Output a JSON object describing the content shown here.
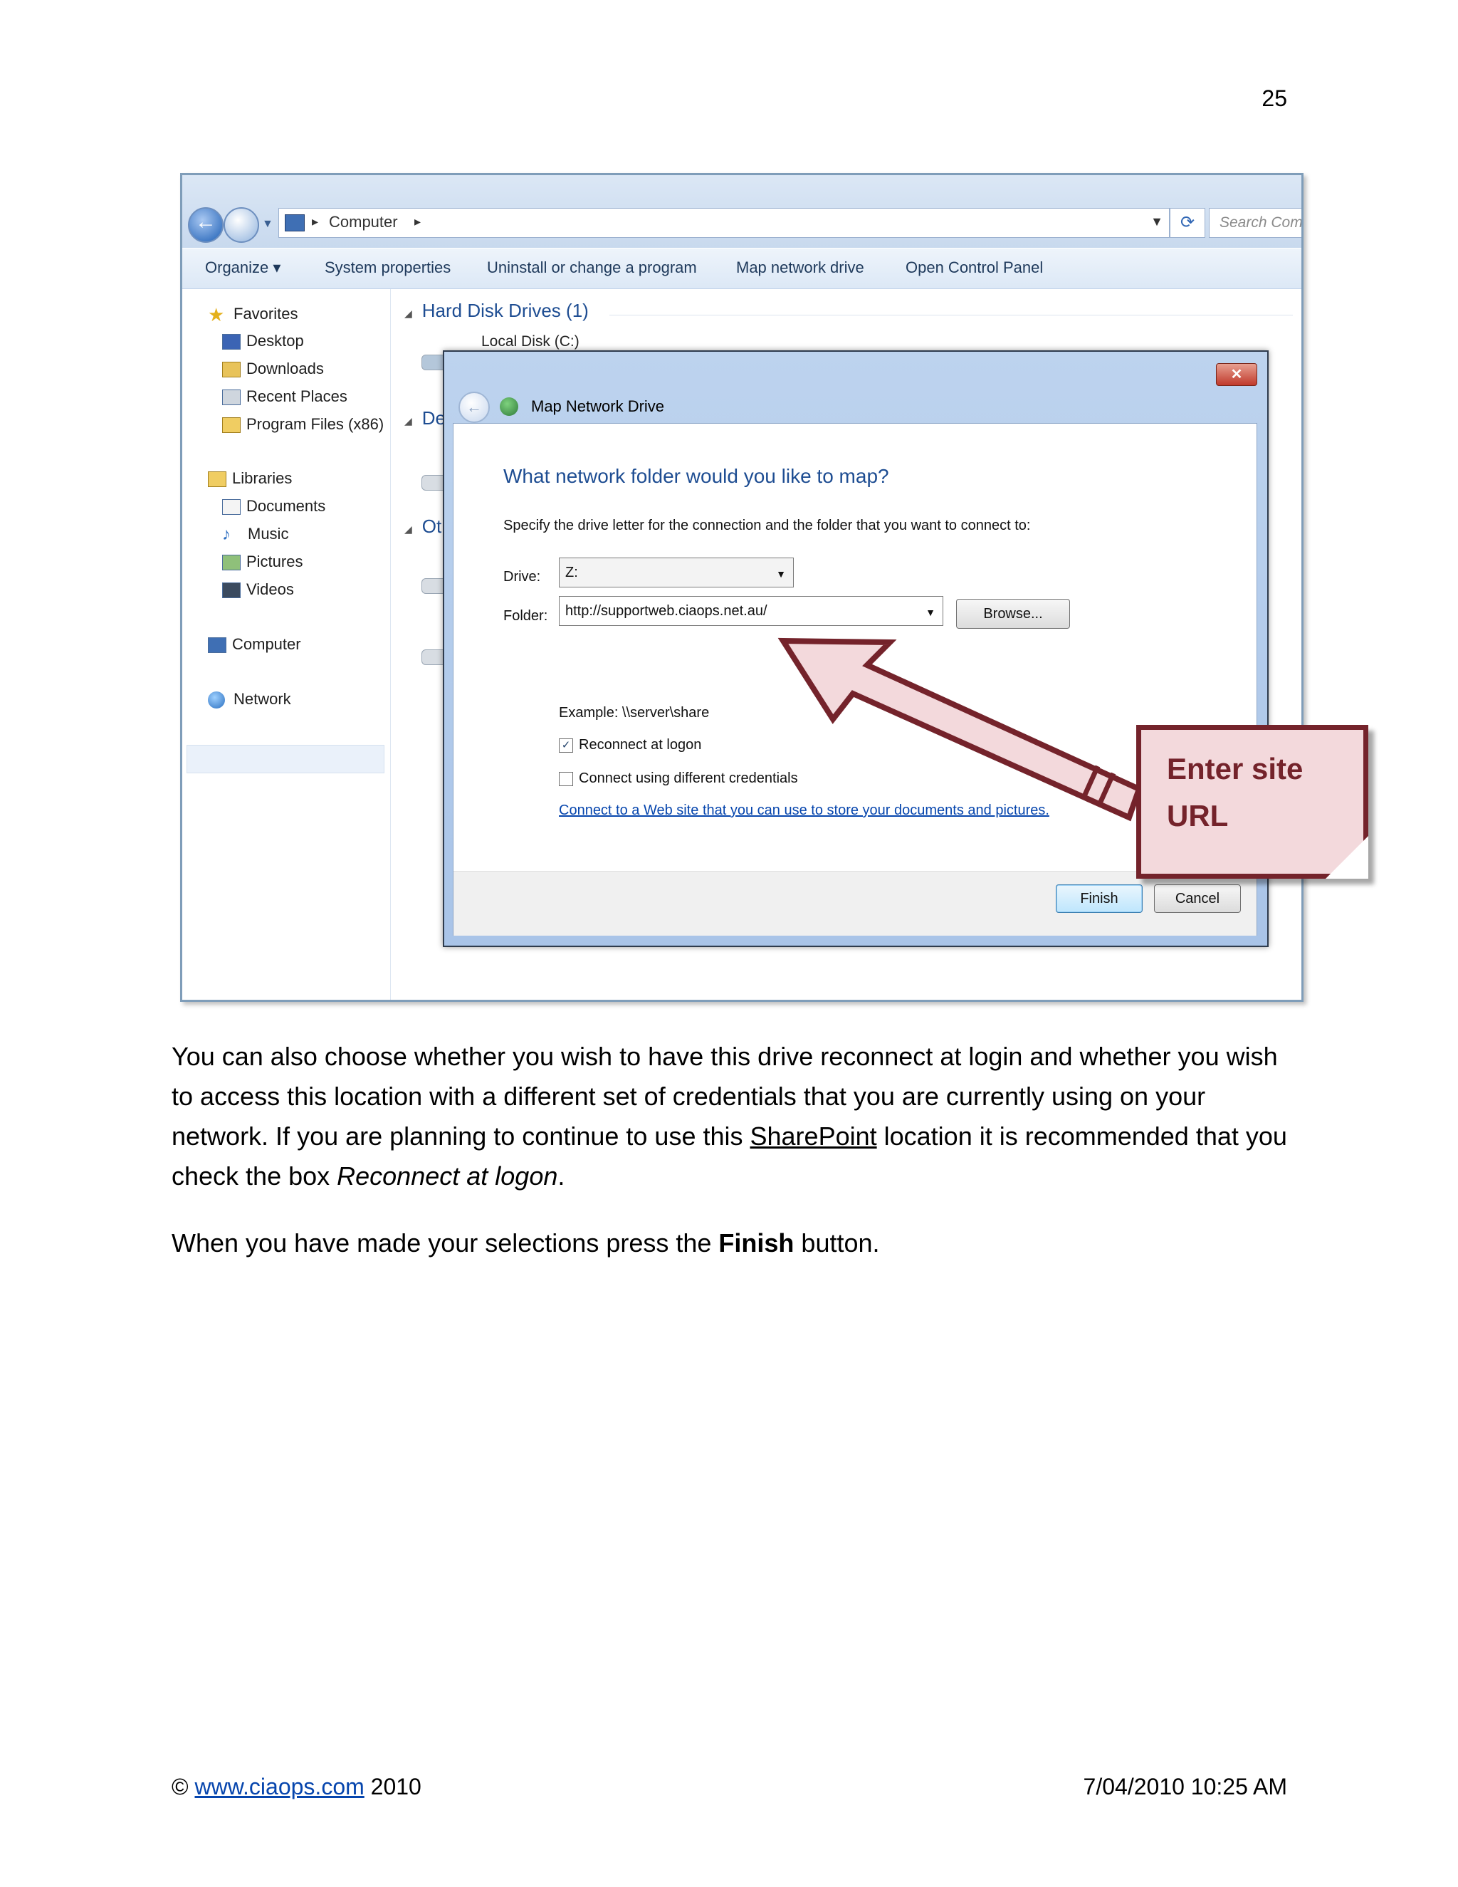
{
  "page_number": "25",
  "explorer": {
    "breadcrumb": "Computer",
    "search_placeholder": "Search Com",
    "toolbar": [
      "Organize ▾",
      "System properties",
      "Uninstall or change a program",
      "Map network drive",
      "Open Control Panel"
    ],
    "nav": {
      "favorites_header": "Favorites",
      "favorites": [
        "Desktop",
        "Downloads",
        "Recent Places",
        "Program Files (x86)"
      ],
      "libraries_header": "Libraries",
      "libraries": [
        "Documents",
        "Music",
        "Pictures",
        "Videos"
      ],
      "computer": "Computer",
      "network": "Network"
    },
    "content": {
      "hard_disk_header": "Hard Disk Drives (1)",
      "local_disk": "Local Disk (C:)",
      "devices_header_partial": "De",
      "other_header_partial": "Ot"
    }
  },
  "dialog": {
    "title": "Map Network Drive",
    "close_label": "✕",
    "heading": "What network folder would you like to map?",
    "instruction": "Specify the drive letter for the connection and the folder that you want to connect to:",
    "drive_label": "Drive:",
    "drive_value": "Z:",
    "folder_label": "Folder:",
    "folder_value": "http://supportweb.ciaops.net.au/",
    "browse_label": "Browse...",
    "example": "Example: \\\\server\\share",
    "reconnect_label": "Reconnect at logon",
    "reconnect_checked": true,
    "different_credentials_label": "Connect using different credentials",
    "different_credentials_checked": false,
    "link_text": "Connect to a Web site that you can use to store your documents and pictures.",
    "finish_label": "Finish",
    "cancel_label": "Cancel"
  },
  "callout": {
    "line1": "Enter site",
    "line2": "URL"
  },
  "body": {
    "para1_a": "You can also choose whether you wish to have this drive reconnect at login and whether you wish to access this location with a different set of credentials that you are currently using on your network. If you are planning to continue to use this ",
    "para1_link": "SharePoint",
    "para1_b": " location it is recommended that you check the box ",
    "para1_em": "Reconnect at logon",
    "para1_end": ".",
    "para2_a": "When you have made your selections press the ",
    "para2_bold": "Finish",
    "para2_b": " button."
  },
  "footer": {
    "copyright": "©",
    "link": "www.ciaops.com",
    "year": "2010",
    "timestamp": "7/04/2010 10:25 AM"
  }
}
